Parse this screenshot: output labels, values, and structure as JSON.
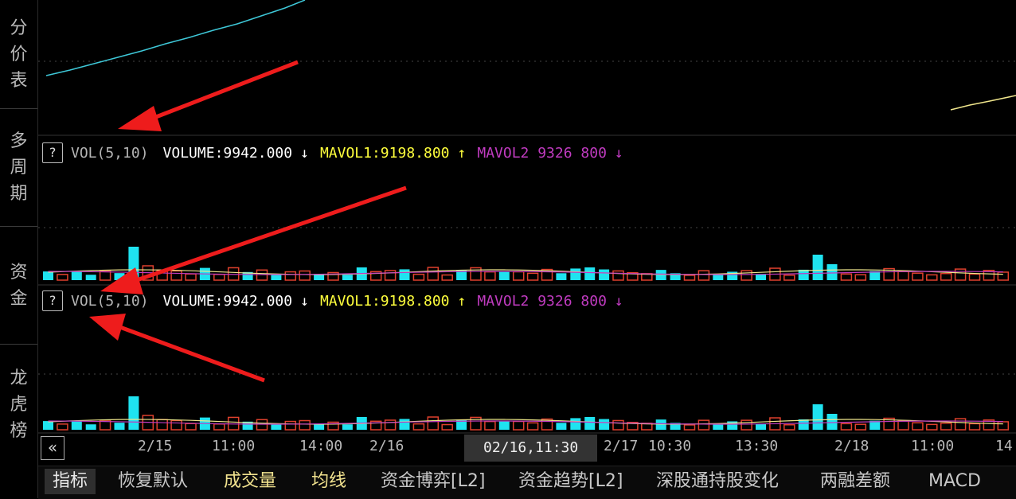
{
  "sidebar": {
    "tabs": [
      {
        "label": [
          "分",
          "价",
          "表"
        ]
      },
      {
        "label": [
          "多",
          "周",
          "期"
        ]
      },
      {
        "label": [
          "资",
          "金"
        ]
      },
      {
        "label": [
          "龙",
          "虎",
          "榜"
        ]
      }
    ]
  },
  "indicator_line": {
    "help": "?",
    "name": "VOL(5,10)",
    "volume_label": "VOLUME:9942.000",
    "volume_arrow": "↓",
    "mavol1_label": "MAVOL1:9198.800",
    "mavol1_arrow": "↑",
    "mavol2_label": "MAVOL2 9326 800",
    "mavol2_arrow": "↓"
  },
  "time_axis": {
    "labels": [
      "2/15",
      "11:00",
      "14:00",
      "2/16",
      "2/17",
      "10:30",
      "13:30",
      "2/18",
      "11:00",
      "14"
    ],
    "tooltip": "02/16,11:30",
    "nav": "«"
  },
  "bottom_tabs": [
    {
      "label": "指标",
      "active": true
    },
    {
      "label": "恢复默认"
    },
    {
      "label": "成交量",
      "highlight": true
    },
    {
      "label": "均线",
      "highlight": true
    },
    {
      "label": "资金博弈[L2]"
    },
    {
      "label": "资金趋势[L2]"
    },
    {
      "label": "深股通持股变化"
    },
    {
      "label": "两融差额"
    },
    {
      "label": "MACD"
    }
  ],
  "colors": {
    "up_bar": "#1fe3f0",
    "down_bar": "#e0412d",
    "ma1": "#f0e68c",
    "ma2": "#c03bc0",
    "price_line": "#3ec8d8",
    "annotation_arrow": "#ee1c1c"
  }
}
